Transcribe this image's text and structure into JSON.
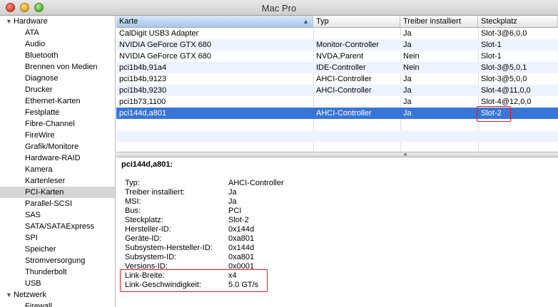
{
  "window": {
    "title": "Mac Pro"
  },
  "sidebar": {
    "groups": [
      {
        "label": "Hardware",
        "expanded": true
      },
      {
        "label": "Netzwerk",
        "expanded": true
      }
    ],
    "hardware_items": [
      "ATA",
      "Audio",
      "Bluetooth",
      "Brennen von Medien",
      "Diagnose",
      "Drucker",
      "Ethernet-Karten",
      "Festplatte",
      "Fibre-Channel",
      "FireWire",
      "Grafik/Monitore",
      "Hardware-RAID",
      "Kamera",
      "Kartenleser",
      "PCI-Karten",
      "Parallel-SCSI",
      "SAS",
      "SATA/SATAExpress",
      "SPI",
      "Speicher",
      "Stromversorgung",
      "Thunderbolt",
      "USB"
    ],
    "network_items": [
      "Firewall"
    ],
    "selected": "PCI-Karten"
  },
  "table": {
    "columns": [
      "Karte",
      "Typ",
      "Treiber installiert",
      "Steckplatz"
    ],
    "sorted_column": "Karte",
    "rows": [
      [
        "CalDigit USB3 Adapter",
        "",
        "Ja",
        "Slot-3@6,0,0"
      ],
      [
        "NVIDIA GeForce GTX 680",
        "Monitor-Controller",
        "Ja",
        "Slot-1"
      ],
      [
        "NVIDIA GeForce GTX 680",
        "NVDA,Parent",
        "Nein",
        "Slot-1"
      ],
      [
        "pci1b4b,91a4",
        "IDE-Controller",
        "Nein",
        "Slot-3@5,0,1"
      ],
      [
        "pci1b4b,9123",
        "AHCI-Controller",
        "Ja",
        "Slot-3@5,0,0"
      ],
      [
        "pci1b4b,9230",
        "AHCI-Controller",
        "Ja",
        "Slot-4@11,0,0"
      ],
      [
        "pci1b73,1100",
        "",
        "Ja",
        "Slot-4@12,0,0"
      ],
      [
        "pci144d,a801",
        "AHCI-Controller",
        "Ja",
        "Slot-2"
      ]
    ],
    "selected_index": 7
  },
  "detail": {
    "title": "pci144d,a801:",
    "fields": [
      [
        "Typ:",
        "AHCI-Controller"
      ],
      [
        "Treiber installiert:",
        "Ja"
      ],
      [
        "MSI:",
        "Ja"
      ],
      [
        "Bus:",
        "PCI"
      ],
      [
        "Steckplatz:",
        "Slot-2"
      ],
      [
        "Hersteller-ID:",
        "0x144d"
      ],
      [
        "Geräte-ID:",
        "0xa801"
      ],
      [
        "Subsystem-Hersteller-ID:",
        "0x144d"
      ],
      [
        "Subsystem-ID:",
        "0xa801"
      ],
      [
        "Versions-ID:",
        "0x0001"
      ],
      [
        "Link-Breite:",
        "x4"
      ],
      [
        "Link-Geschwindigkeit:",
        "5.0 GT/s"
      ]
    ]
  },
  "colors": {
    "selection": "#3875d7",
    "alt_row": "#edf3fe",
    "highlight": "#e01a1a"
  }
}
